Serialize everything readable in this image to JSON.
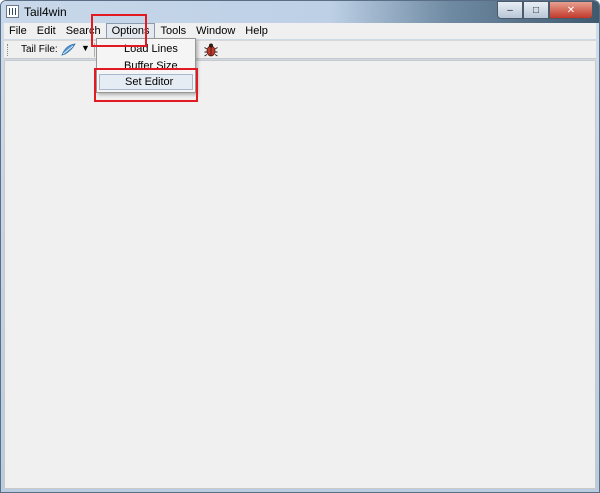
{
  "window": {
    "title": "Tail4win",
    "controls": {
      "minimize": "–",
      "maximize": "□",
      "close": "✕"
    }
  },
  "menubar": {
    "items": [
      {
        "label": "File"
      },
      {
        "label": "Edit"
      },
      {
        "label": "Search"
      },
      {
        "label": "Options",
        "state": "open"
      },
      {
        "label": "Tools"
      },
      {
        "label": "Window"
      },
      {
        "label": "Help"
      }
    ]
  },
  "toolbar": {
    "tail_file_label": "Tail File:",
    "open_icon": "open-file-icon",
    "dropdown_arrow": "▼",
    "bug_icon": "bug-icon"
  },
  "options_menu": {
    "items": [
      {
        "label": "Load Lines"
      },
      {
        "label": "Buffer Size"
      },
      {
        "label": "Set Editor",
        "state": "hover"
      }
    ]
  },
  "colors": {
    "highlight_box": "#e21b23",
    "menu_background": "#f0f0f0"
  }
}
